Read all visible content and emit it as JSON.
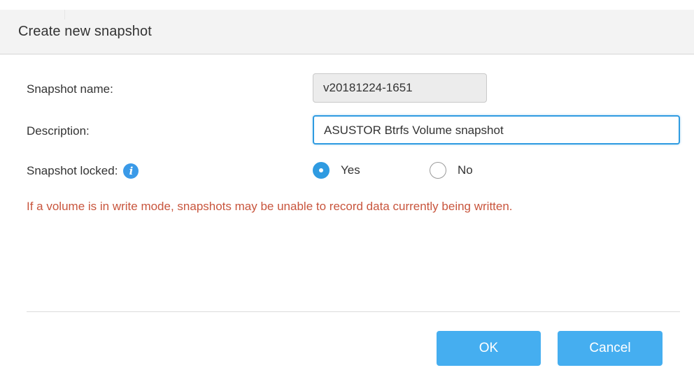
{
  "dialog": {
    "title": "Create new snapshot"
  },
  "form": {
    "snapshot_name_label": "Snapshot name:",
    "snapshot_name_value": "v20181224-1651",
    "description_label": "Description:",
    "description_value": "ASUSTOR Btrfs Volume snapshot",
    "locked_label": "Snapshot locked:",
    "info_icon_glyph": "i",
    "locked_options": [
      {
        "label": "Yes",
        "checked": true
      },
      {
        "label": "No",
        "checked": false
      }
    ]
  },
  "warning": "If a volume is in write mode, snapshots may be unable to record data currently being written.",
  "buttons": {
    "ok_label": "OK",
    "cancel_label": "Cancel"
  },
  "colors": {
    "accent": "#2f9be1",
    "button": "#45aef0",
    "warning": "#c8553d"
  },
  "icons": {
    "info": "info-icon"
  }
}
